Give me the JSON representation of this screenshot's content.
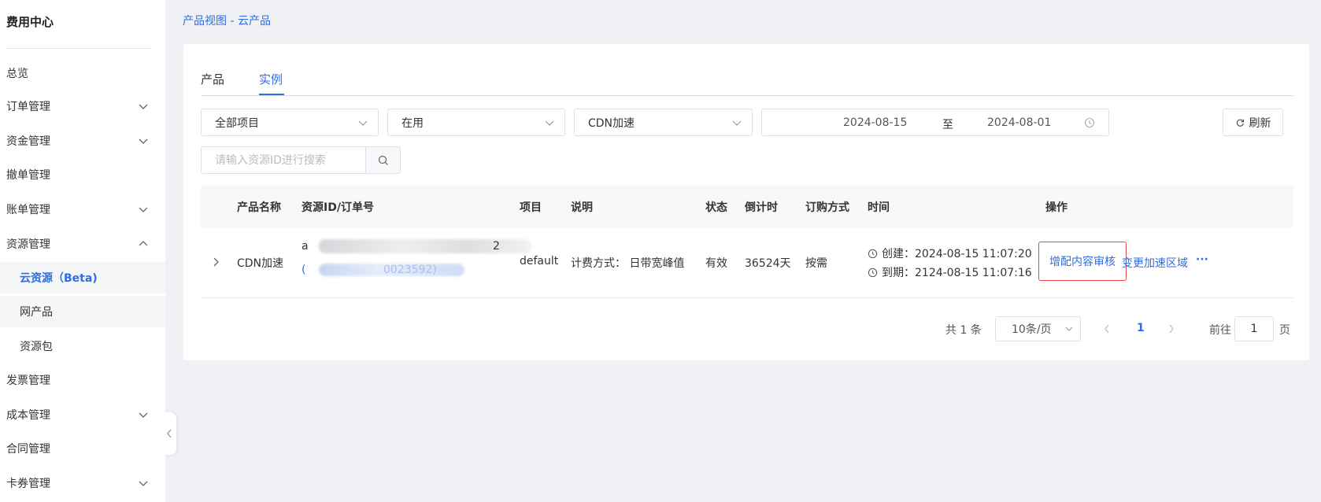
{
  "sidebar": {
    "title": "费用中心",
    "items": [
      {
        "label": "总览"
      },
      {
        "label": "订单管理"
      },
      {
        "label": "资金管理"
      },
      {
        "label": "撤单管理"
      },
      {
        "label": "账单管理"
      },
      {
        "label": "资源管理"
      },
      {
        "label": "云资源（Beta)"
      },
      {
        "label": "网产品"
      },
      {
        "label": "资源包"
      },
      {
        "label": "发票管理"
      },
      {
        "label": "成本管理"
      },
      {
        "label": "合同管理"
      },
      {
        "label": "卡券管理"
      }
    ]
  },
  "breadcrumb": "产品视图 - 云产品",
  "tabs": [
    {
      "label": "产品"
    },
    {
      "label": "实例"
    }
  ],
  "filters": {
    "project": "全部项目",
    "status": "在用",
    "product": "CDN加速",
    "date_start": "2024-08-15",
    "date_sep": "至",
    "date_end": "2024-08-01",
    "refresh_label": "刷新",
    "search_placeholder": "请输入资源ID进行搜索"
  },
  "table": {
    "headers": [
      "产品名称",
      "资源ID/订单号",
      "项目",
      "说明",
      "状态",
      "倒计时",
      "订购方式",
      "时间",
      "操作"
    ],
    "rows": [
      {
        "product_name": "CDN加速",
        "resource_id_prefix": "a",
        "resource_id_suffix": "2",
        "order_prefix": "(",
        "order_suffix": "0023592)",
        "project": "default",
        "description": "计费方式： 日带宽峰值",
        "status": "有效",
        "countdown": "36524天",
        "order_type": "按需",
        "created": "创建：2024-08-15 11:07:20",
        "expires": "到期：2124-08-15 11:07:16",
        "action_1": "增配内容审核",
        "action_2": "变更加速区域",
        "action_more": "···"
      }
    ]
  },
  "pagination": {
    "total": "共 1 条",
    "page_size": "10条/页",
    "current_page": "1",
    "goto_label": "前往",
    "goto_value": "1",
    "goto_unit": "页"
  },
  "colors": {
    "accent": "#2f6de2",
    "highlight_border": "#e54545"
  }
}
